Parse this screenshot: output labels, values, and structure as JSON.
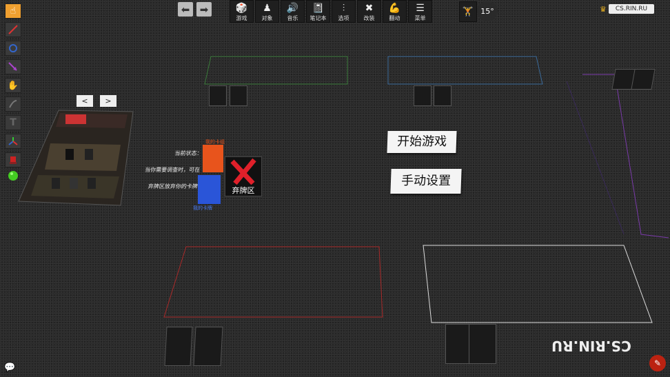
{
  "left_toolbar": {
    "tools": [
      "pointer-icon",
      "line-icon",
      "circle-icon",
      "arrow-icon",
      "gizmo-icon",
      "joint-icon",
      "text-icon",
      "axis-icon",
      "flag-icon",
      "green-orb-icon"
    ]
  },
  "nav": {
    "back": "⬅",
    "forward": "➡"
  },
  "top_menu": {
    "items": [
      {
        "icon": "game-icon",
        "glyph": "🎲",
        "label": "游戏"
      },
      {
        "icon": "pawn-icon",
        "glyph": "♟",
        "label": "对象"
      },
      {
        "icon": "speaker-icon",
        "glyph": "🔊",
        "label": "音乐"
      },
      {
        "icon": "notebook-icon",
        "glyph": "📓",
        "label": "笔记本"
      },
      {
        "icon": "sliders-icon",
        "glyph": "⫶",
        "label": "选项"
      },
      {
        "icon": "tools-icon",
        "glyph": "✖",
        "label": "改装"
      },
      {
        "icon": "flex-icon",
        "glyph": "💪",
        "label": "翻动"
      },
      {
        "icon": "menu-icon",
        "glyph": "☰",
        "label": "菜单"
      }
    ],
    "camera_angle": "15°",
    "host": "CS.RIN.RU"
  },
  "page_arrows": {
    "prev": "<",
    "next": ">"
  },
  "board": {
    "start_game": "开始游戏",
    "manual_setup": "手动设置",
    "discard_label": "弃牌区",
    "red_label": "我的卡组",
    "blue_label": "我的卡牌",
    "hint_text_1": "当前状态：",
    "hint_text_2": "当你需要调查时，可在",
    "hint_text_3": "弃牌区放弃你的卡牌",
    "watermark": "CS.RIN.RU",
    "chat_icon": "chat-icon",
    "edit_icon": "pencil-icon"
  },
  "colors": {
    "accent": "#f0a030",
    "zone_green": "#3a7a3a",
    "zone_blue": "#3a6a9a",
    "zone_red": "#aa2a2a",
    "zone_white": "#dddddd",
    "zone_purple": "#7a3aaa",
    "deck_red": "#e8541c",
    "deck_blue": "#2a55d8"
  }
}
